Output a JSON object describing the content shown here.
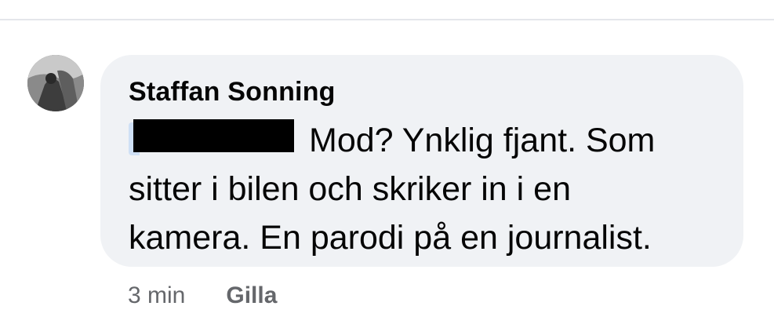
{
  "comment": {
    "author": "Staffan Sonning",
    "text_lines": [
      "Mod? Ynklig fjant. Som",
      "sitter i bilen och skriker in i en",
      "kamera. En parodi på en journalist."
    ],
    "timestamp": "3 min",
    "like_label": "Gilla"
  },
  "icons": {
    "avatar": "profile-photo"
  },
  "colors": {
    "bubble_background": "#f0f2f5",
    "meta_text": "#65676b",
    "text": "#050505",
    "redaction": "#000000"
  }
}
